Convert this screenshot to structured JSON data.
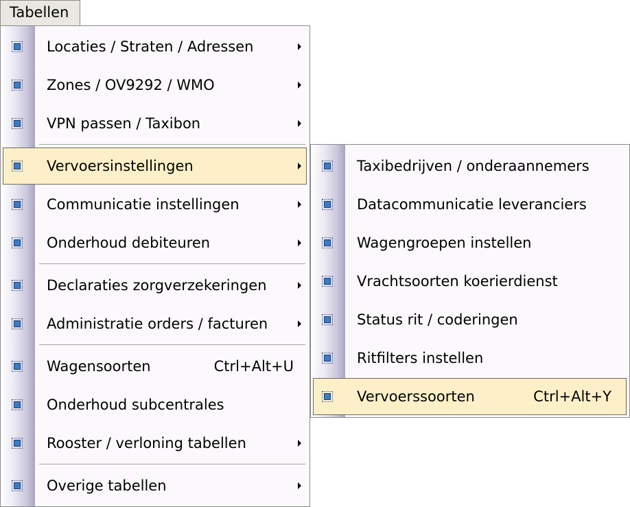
{
  "menubar": {
    "label": "Tabellen"
  },
  "main_menu": {
    "items": [
      {
        "label": "Locaties / Straten / Adressen",
        "shortcut": "",
        "submenu": true
      },
      {
        "label": "Zones / OV9292 / WMO",
        "shortcut": "",
        "submenu": true
      },
      {
        "label": "VPN passen / Taxibon",
        "shortcut": "",
        "submenu": true
      },
      {
        "label": "Vervoersinstellingen",
        "shortcut": "",
        "submenu": true,
        "selected": true
      },
      {
        "label": "Communicatie instellingen",
        "shortcut": "",
        "submenu": true
      },
      {
        "label": "Onderhoud debiteuren",
        "shortcut": "",
        "submenu": true
      },
      {
        "label": "Declaraties zorgverzekeringen",
        "shortcut": "",
        "submenu": true
      },
      {
        "label": "Administratie orders / facturen",
        "shortcut": "",
        "submenu": true
      },
      {
        "label": "Wagensoorten",
        "shortcut": "Ctrl+Alt+U",
        "submenu": false
      },
      {
        "label": "Onderhoud subcentrales",
        "shortcut": "",
        "submenu": false
      },
      {
        "label": "Rooster / verloning tabellen",
        "shortcut": "",
        "submenu": true
      },
      {
        "label": "Overige tabellen",
        "shortcut": "",
        "submenu": true
      }
    ]
  },
  "sub_menu": {
    "items": [
      {
        "label": "Taxibedrijven / onderaannemers",
        "shortcut": ""
      },
      {
        "label": "Datacommunicatie leveranciers",
        "shortcut": ""
      },
      {
        "label": "Wagengroepen instellen",
        "shortcut": ""
      },
      {
        "label": "Vrachtsoorten koerierdienst",
        "shortcut": ""
      },
      {
        "label": "Status rit / coderingen",
        "shortcut": ""
      },
      {
        "label": "Ritfilters instellen",
        "shortcut": ""
      },
      {
        "label": "Vervoerssoorten",
        "shortcut": "Ctrl+Alt+Y",
        "selected": true
      }
    ]
  },
  "icons": {
    "menu_item": "blue-square-icon",
    "submenu_indicator": "triangle-right-icon"
  },
  "colors": {
    "menu_background": "#fcf9fc",
    "highlight_background": "#fdf0c8",
    "icon_fill": "#3c7bc6",
    "gutter_gradient_end": "#a9a4c2"
  }
}
